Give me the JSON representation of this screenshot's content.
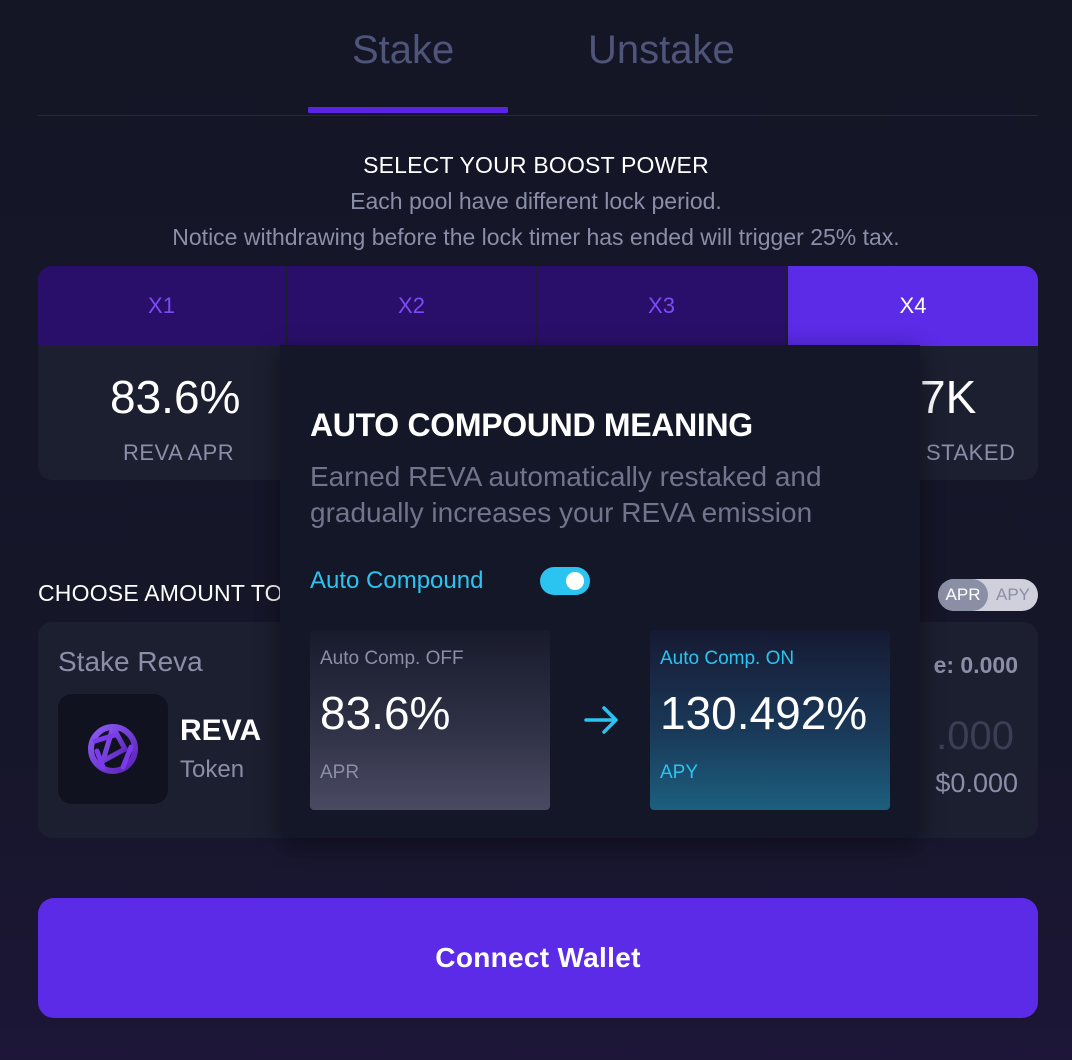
{
  "tabs": {
    "stake": "Stake",
    "unstake": "Unstake"
  },
  "boost": {
    "title": "SELECT YOUR BOOST POWER",
    "subtitle1": "Each pool have different lock period.",
    "subtitle2": "Notice withdrawing before the lock timer has ended will trigger 25% tax.",
    "options": [
      "X1",
      "X2",
      "X3",
      "X4"
    ],
    "active_option": "X4",
    "apr_value": "83.6%",
    "apr_label": "REVA APR",
    "staked_value": "7K",
    "staked_label": "STAKED"
  },
  "amount": {
    "label": "CHOOSE AMOUNT TO",
    "toggle": {
      "apr": "APR",
      "apy": "APY",
      "selected": "APR"
    },
    "stake_title": "Stake Reva",
    "token_name": "REVA",
    "token_type": "Token",
    "balance": "e: 0.000",
    "amount_value": ".000",
    "usd_value": "$0.000"
  },
  "connect_button": "Connect Wallet",
  "popover": {
    "title": "AUTO COMPOUND MEANING",
    "description": "Earned REVA automatically restaked and gradually increases your REVA emission",
    "toggle_label": "Auto Compound",
    "toggle_on": true,
    "off_box": {
      "label": "Auto Comp. OFF",
      "value": "83.6%",
      "unit": "APR"
    },
    "on_box": {
      "label": "Auto Comp. ON",
      "value": "130.492%",
      "unit": "APY"
    }
  },
  "colors": {
    "accent_purple": "#5b2be7",
    "accent_cyan": "#2bc4f0",
    "background": "#141626"
  }
}
